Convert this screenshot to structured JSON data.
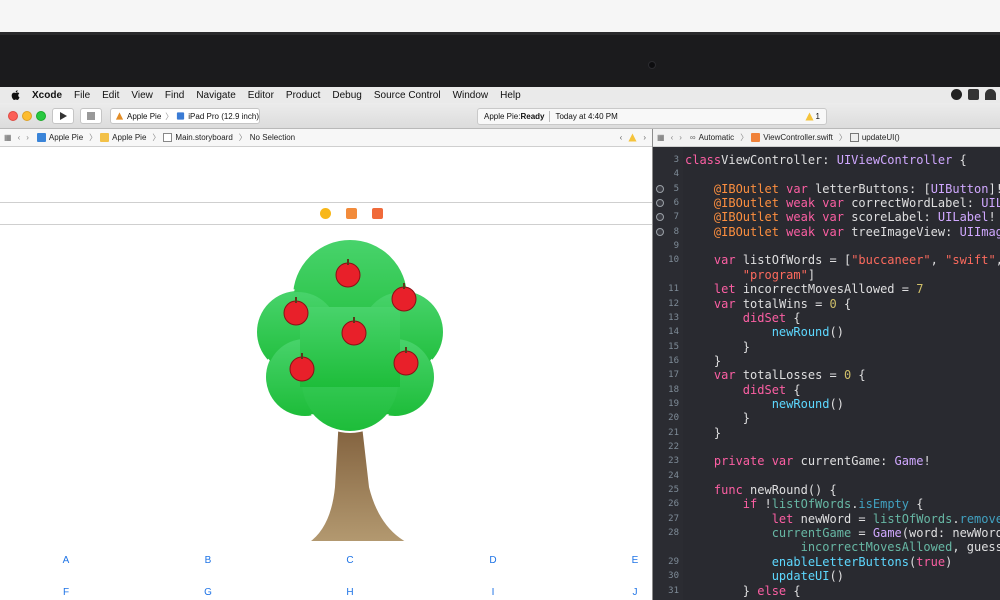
{
  "menubar": {
    "items": [
      "Xcode",
      "File",
      "Edit",
      "View",
      "Find",
      "Navigate",
      "Editor",
      "Product",
      "Debug",
      "Source Control",
      "Window",
      "Help"
    ]
  },
  "toolbar": {
    "scheme_target": "Apple Pie",
    "scheme_device": "iPad Pro (12.9 inch)",
    "status_title": "Apple Pie: ",
    "status_state": "Ready",
    "status_time": "Today at 4:40 PM",
    "warning_count": "1"
  },
  "jumpbar_left": {
    "crumbs": [
      "Apple Pie",
      "Apple Pie",
      "Main.storyboard",
      "No Selection"
    ]
  },
  "jumpbar_right": {
    "crumbs": [
      "Automatic",
      "ViewController.swift",
      "updateUI()"
    ]
  },
  "canvas": {
    "letters_row1": [
      "A",
      "B",
      "C",
      "D",
      "E"
    ],
    "letters_row2": [
      "F",
      "G",
      "H",
      "I",
      "J"
    ]
  },
  "editor": {
    "lines": [
      {
        "n": "3",
        "outlet": false,
        "tokens": [
          [
            "kw",
            "class"
          ],
          [
            "",
            "ViewController: "
          ],
          [
            "ty",
            "UIViewController"
          ],
          [
            "",
            " {"
          ]
        ]
      },
      {
        "n": "4",
        "outlet": false,
        "tokens": []
      },
      {
        "n": "5",
        "outlet": true,
        "tokens": [
          [
            "",
            "    "
          ],
          [
            "at",
            "@IBOutlet"
          ],
          [
            "",
            " "
          ],
          [
            "kw",
            "var"
          ],
          [
            "",
            " letterButtons: ["
          ],
          [
            "ty",
            "UIButton"
          ],
          [
            "",
            "]!"
          ]
        ]
      },
      {
        "n": "6",
        "outlet": true,
        "tokens": [
          [
            "",
            "    "
          ],
          [
            "at",
            "@IBOutlet"
          ],
          [
            "",
            " "
          ],
          [
            "kw",
            "weak var"
          ],
          [
            "",
            " correctWordLabel: "
          ],
          [
            "ty",
            "UILabel"
          ],
          [
            "",
            "!"
          ]
        ]
      },
      {
        "n": "7",
        "outlet": true,
        "tokens": [
          [
            "",
            "    "
          ],
          [
            "at",
            "@IBOutlet"
          ],
          [
            "",
            " "
          ],
          [
            "kw",
            "weak var"
          ],
          [
            "",
            " scoreLabel: "
          ],
          [
            "ty",
            "UILabel"
          ],
          [
            "",
            "!"
          ]
        ]
      },
      {
        "n": "8",
        "outlet": true,
        "tokens": [
          [
            "",
            "    "
          ],
          [
            "at",
            "@IBOutlet"
          ],
          [
            "",
            " "
          ],
          [
            "kw",
            "weak var"
          ],
          [
            "",
            " treeImageView: "
          ],
          [
            "ty",
            "UIImageView"
          ],
          [
            "",
            "!"
          ]
        ]
      },
      {
        "n": "9",
        "outlet": false,
        "tokens": []
      },
      {
        "n": "10",
        "outlet": false,
        "tokens": [
          [
            "",
            "    "
          ],
          [
            "kw",
            "var"
          ],
          [
            "",
            " listOfWords = ["
          ],
          [
            "st",
            "\"buccaneer\""
          ],
          [
            "",
            ", "
          ],
          [
            "st",
            "\"swift\""
          ],
          [
            "",
            ","
          ]
        ]
      },
      {
        "n": "",
        "outlet": false,
        "tokens": [
          [
            "",
            "        "
          ],
          [
            "st",
            "\"program\""
          ],
          [
            "",
            "]"
          ]
        ]
      },
      {
        "n": "11",
        "outlet": false,
        "tokens": [
          [
            "",
            "    "
          ],
          [
            "kw",
            "let"
          ],
          [
            "",
            " incorrectMovesAllowed = "
          ],
          [
            "nu",
            "7"
          ]
        ]
      },
      {
        "n": "12",
        "outlet": false,
        "tokens": [
          [
            "",
            "    "
          ],
          [
            "kw",
            "var"
          ],
          [
            "",
            " totalWins = "
          ],
          [
            "nu",
            "0"
          ],
          [
            "",
            " {"
          ]
        ]
      },
      {
        "n": "13",
        "outlet": false,
        "tokens": [
          [
            "",
            "        "
          ],
          [
            "kw",
            "didSet"
          ],
          [
            "",
            " {"
          ]
        ]
      },
      {
        "n": "14",
        "outlet": false,
        "tokens": [
          [
            "",
            "            "
          ],
          [
            "tf",
            "newRound"
          ],
          [
            "",
            "()"
          ]
        ]
      },
      {
        "n": "15",
        "outlet": false,
        "tokens": [
          [
            "",
            "        }"
          ]
        ]
      },
      {
        "n": "16",
        "outlet": false,
        "tokens": [
          [
            "",
            "    }"
          ]
        ]
      },
      {
        "n": "17",
        "outlet": false,
        "tokens": [
          [
            "",
            "    "
          ],
          [
            "kw",
            "var"
          ],
          [
            "",
            " totalLosses = "
          ],
          [
            "nu",
            "0"
          ],
          [
            "",
            " {"
          ]
        ]
      },
      {
        "n": "18",
        "outlet": false,
        "tokens": [
          [
            "",
            "        "
          ],
          [
            "kw",
            "didSet"
          ],
          [
            "",
            " {"
          ]
        ]
      },
      {
        "n": "19",
        "outlet": false,
        "tokens": [
          [
            "",
            "            "
          ],
          [
            "tf",
            "newRound"
          ],
          [
            "",
            "()"
          ]
        ]
      },
      {
        "n": "20",
        "outlet": false,
        "tokens": [
          [
            "",
            "        }"
          ]
        ]
      },
      {
        "n": "21",
        "outlet": false,
        "tokens": [
          [
            "",
            "    }"
          ]
        ]
      },
      {
        "n": "22",
        "outlet": false,
        "tokens": []
      },
      {
        "n": "23",
        "outlet": false,
        "tokens": [
          [
            "",
            "    "
          ],
          [
            "kw",
            "private var"
          ],
          [
            "",
            " currentGame: "
          ],
          [
            "ty",
            "Game"
          ],
          [
            "",
            "!"
          ]
        ]
      },
      {
        "n": "24",
        "outlet": false,
        "tokens": []
      },
      {
        "n": "25",
        "outlet": false,
        "tokens": [
          [
            "",
            "    "
          ],
          [
            "kw",
            "func"
          ],
          [
            "",
            " newRound() {"
          ]
        ]
      },
      {
        "n": "26",
        "outlet": false,
        "tokens": [
          [
            "",
            "        "
          ],
          [
            "kw",
            "if"
          ],
          [
            "",
            " !"
          ],
          [
            "tv",
            "listOfWords"
          ],
          [
            "",
            "."
          ],
          [
            "fn",
            "isEmpty"
          ],
          [
            "",
            " {"
          ]
        ]
      },
      {
        "n": "27",
        "outlet": false,
        "tokens": [
          [
            "",
            "            "
          ],
          [
            "kw",
            "let"
          ],
          [
            "",
            " newWord = "
          ],
          [
            "tv",
            "listOfWords"
          ],
          [
            "",
            "."
          ],
          [
            "fn",
            "removeFirst"
          ],
          [
            "",
            "()"
          ]
        ]
      },
      {
        "n": "28",
        "outlet": false,
        "tokens": [
          [
            "",
            "            "
          ],
          [
            "tv",
            "currentGame"
          ],
          [
            "",
            " = "
          ],
          [
            "ty",
            "Game"
          ],
          [
            "",
            "(word: newWord,"
          ]
        ]
      },
      {
        "n": "",
        "outlet": false,
        "tokens": [
          [
            "",
            "                "
          ],
          [
            "tv",
            "incorrectMovesAllowed"
          ],
          [
            "",
            ", guessedLetters: [])"
          ]
        ]
      },
      {
        "n": "29",
        "outlet": false,
        "tokens": [
          [
            "",
            "            "
          ],
          [
            "tf",
            "enableLetterButtons"
          ],
          [
            "",
            "("
          ],
          [
            "kw",
            "true"
          ],
          [
            "",
            ")"
          ]
        ]
      },
      {
        "n": "30",
        "outlet": false,
        "tokens": [
          [
            "",
            "            "
          ],
          [
            "tf",
            "updateUI"
          ],
          [
            "",
            "()"
          ]
        ]
      },
      {
        "n": "31",
        "outlet": false,
        "tokens": [
          [
            "",
            "        } "
          ],
          [
            "kw",
            "else"
          ],
          [
            "",
            " {"
          ]
        ]
      }
    ]
  },
  "colors": {
    "editor_bg": "#292a30",
    "canvas_letter": "#1d73e6",
    "leaf_green": "#2ecc40",
    "apple_red": "#e8202a",
    "trunk": "#9c7a4e"
  }
}
